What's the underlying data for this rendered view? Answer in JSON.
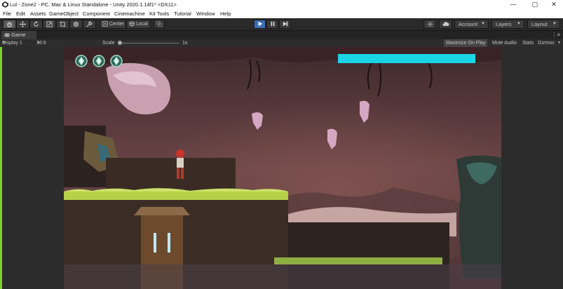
{
  "window": {
    "title": "Lul - Zone2 - PC, Mac & Linux Standalone - Unity 2020.1.14f1* <DX11>",
    "controls": {
      "minimize": "—",
      "maximize": "▢",
      "close": "✕"
    }
  },
  "menu": [
    "File",
    "Edit",
    "Assets",
    "GameObject",
    "Component",
    "Cinemachine",
    "Kit Tools",
    "Tutorial",
    "Window",
    "Help"
  ],
  "toolbar": {
    "pivot_label": "Center",
    "space_label": "Local",
    "account_label": "Account",
    "layers_label": "Layers",
    "layout_label": "Layout"
  },
  "game_tab": {
    "label": "Game",
    "menu_glyph": "⋮≡"
  },
  "game_bar": {
    "display": "Display 1",
    "aspect": "16:9",
    "scale_label": "Scale",
    "scale_value": "1x",
    "maximize_on_play": "Maximize On Play",
    "mute_audio": "Mute Audio",
    "stats": "Stats",
    "gizmos": "Gizmos"
  },
  "hud": {
    "lives": 3,
    "health_fill": 1.0
  },
  "colors": {
    "accent_green": "#7ad02c",
    "play_blue": "#3b6fb4",
    "health_bar": "#19d6e6",
    "sky": "#5e3a3f",
    "grass": "#b6d04a"
  }
}
